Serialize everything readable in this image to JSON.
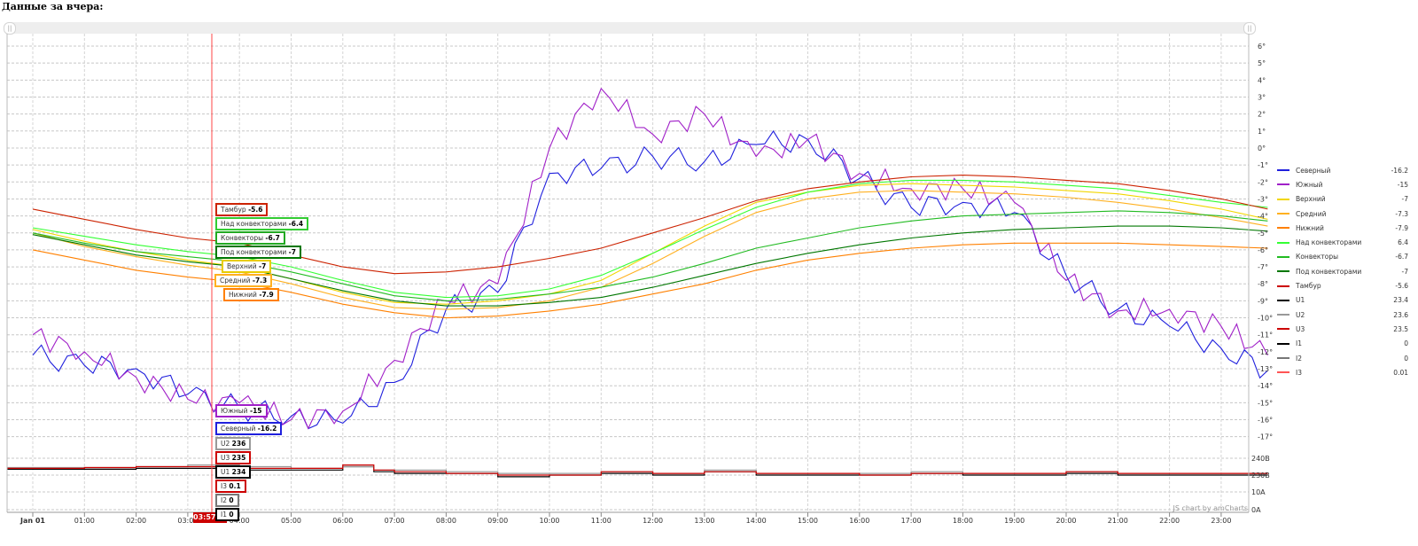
{
  "heading": "Данные за вчера:",
  "scroll": {
    "left_grip": "||",
    "right_grip": "||"
  },
  "credit": "JS chart by amCharts",
  "cursor_time": "03:57:15",
  "colors": {
    "north": "#2020dd",
    "south": "#a020c8",
    "top": "#f2d600",
    "middle": "#ffb020",
    "bottom": "#ff8000",
    "above_conv": "#33ff33",
    "conv": "#22bb22",
    "below_conv": "#007700",
    "tambur": "#cc2200",
    "u1": "#000000",
    "u2": "#999999",
    "u3": "#cc0000",
    "i1": "#000000",
    "i2": "#777777",
    "i3": "#ff5555"
  },
  "legend": [
    {
      "name": "Северный",
      "value": "-16.2",
      "color": "#2020dd"
    },
    {
      "name": "Южный",
      "value": "-15",
      "color": "#a020c8"
    },
    {
      "name": "Верхний",
      "value": "-7",
      "color": "#f2d600"
    },
    {
      "name": "Средний",
      "value": "-7.3",
      "color": "#ffb020"
    },
    {
      "name": "Нижний",
      "value": "-7.9",
      "color": "#ff8000"
    },
    {
      "name": "Над конвекторами",
      "value": "6.4",
      "color": "#33ff33"
    },
    {
      "name": "Конвекторы",
      "value": "-6.7",
      "color": "#22bb22"
    },
    {
      "name": "Под конвекторами",
      "value": "-7",
      "color": "#007700"
    },
    {
      "name": "Тамбур",
      "value": "-5.6",
      "color": "#cc0000"
    },
    {
      "name": "U1",
      "value": "23.4",
      "color": "#000000"
    },
    {
      "name": "U2",
      "value": "23.6",
      "color": "#999999"
    },
    {
      "name": "U3",
      "value": "23.5",
      "color": "#cc0000"
    },
    {
      "name": "I1",
      "value": "0",
      "color": "#000000"
    },
    {
      "name": "I2",
      "value": "0",
      "color": "#777777"
    },
    {
      "name": "I3",
      "value": "0.01",
      "color": "#ff5555"
    }
  ],
  "balloons": [
    {
      "label": "Тамбур",
      "value": "-5.6",
      "color": "#cc2200"
    },
    {
      "label": "Над конвекторами",
      "value": "-6.4",
      "color": "#33cc33"
    },
    {
      "label": "Конвекторы",
      "value": "-6.7",
      "color": "#22aa22"
    },
    {
      "label": "Под конвекторами",
      "value": "-7",
      "color": "#007700"
    },
    {
      "label": "Верхний",
      "value": "-7",
      "color": "#e8cc00"
    },
    {
      "label": "Средний",
      "value": "-7.3",
      "color": "#ffb020"
    },
    {
      "label": "Нижний",
      "value": "-7.9",
      "color": "#ff8000"
    },
    {
      "label": "Южный",
      "value": "-15",
      "color": "#a020c8"
    },
    {
      "label": "Северный",
      "value": "-16.2",
      "color": "#2020dd"
    },
    {
      "label": "U2",
      "value": "236",
      "color": "#999999"
    },
    {
      "label": "U3",
      "value": "235",
      "color": "#cc0000"
    },
    {
      "label": "U1",
      "value": "234",
      "color": "#000000"
    },
    {
      "label": "I3",
      "value": "0.1",
      "color": "#cc0000"
    },
    {
      "label": "I2",
      "value": "0",
      "color": "#777777"
    },
    {
      "label": "I1",
      "value": "0",
      "color": "#000000"
    }
  ],
  "chart_data": {
    "type": "line",
    "x_ticks": [
      "Jan 01",
      "01:00",
      "02:00",
      "03:00",
      "04:00",
      "05:00",
      "06:00",
      "07:00",
      "08:00",
      "09:00",
      "10:00",
      "11:00",
      "12:00",
      "13:00",
      "14:00",
      "15:00",
      "16:00",
      "17:00",
      "18:00",
      "19:00",
      "20:00",
      "21:00",
      "22:00",
      "23:00"
    ],
    "y_ticks": [
      "6°",
      "5°",
      "4°",
      "3°",
      "2°",
      "1°",
      "0°",
      "-1°",
      "-2°",
      "-3°",
      "-4°",
      "-5°",
      "-6°",
      "-7°",
      "-8°",
      "-9°",
      "-10°",
      "-11°",
      "-12°",
      "-13°",
      "-14°",
      "-15°",
      "-16°",
      "-17°"
    ],
    "y2_ticks": [
      "240В",
      "230В",
      "10А",
      "0А"
    ],
    "ylim": [
      -17,
      6
    ],
    "x_hours": [
      0,
      1,
      2,
      3,
      4,
      5,
      6,
      7,
      8,
      9,
      10,
      11,
      12,
      13,
      14,
      15,
      16,
      17,
      18,
      19,
      20,
      21,
      22,
      23,
      23.9
    ],
    "series": [
      {
        "name": "Северный",
        "color": "#2020dd",
        "values": [
          -12.2,
          -12.8,
          -13,
          -14.5,
          -15.3,
          -15.8,
          -16.2,
          -13.8,
          -9.5,
          -8.5,
          -1.5,
          -1.2,
          -0.5,
          -0.8,
          0.2,
          0.5,
          -1.8,
          -3.5,
          -3.2,
          -3.8,
          -7.5,
          -9.5,
          -10.5,
          -11.8,
          -13.1
        ]
      },
      {
        "name": "Южный",
        "color": "#a020c8",
        "values": [
          -11,
          -12,
          -13.5,
          -14.8,
          -15,
          -16,
          -15.5,
          -12.5,
          -9,
          -8,
          0,
          3.5,
          0.8,
          2,
          -0.5,
          0.5,
          -1.5,
          -2.4,
          -2.4,
          -3.2,
          -7.8,
          -9.6,
          -9.5,
          -10.5,
          -12.2
        ]
      },
      {
        "name": "Верхний",
        "color": "#f2d600",
        "values": [
          -4.8,
          -5.5,
          -6.1,
          -6.6,
          -7,
          -7.7,
          -8.5,
          -9.1,
          -9.2,
          -9,
          -8.6,
          -7.8,
          -6.2,
          -4.6,
          -3.2,
          -2.6,
          -2.2,
          -2.1,
          -2.2,
          -2.3,
          -2.5,
          -2.7,
          -3.1,
          -3.6,
          -4.2
        ]
      },
      {
        "name": "Средний",
        "color": "#ffb020",
        "values": [
          -5,
          -5.8,
          -6.4,
          -6.9,
          -7.3,
          -8,
          -8.8,
          -9.4,
          -9.5,
          -9.4,
          -9,
          -8.2,
          -6.8,
          -5.2,
          -3.8,
          -3,
          -2.6,
          -2.5,
          -2.6,
          -2.7,
          -2.9,
          -3.2,
          -3.6,
          -4.1,
          -4.6
        ]
      },
      {
        "name": "Нижний",
        "color": "#ff8000",
        "values": [
          -6,
          -6.6,
          -7.2,
          -7.6,
          -7.9,
          -8.5,
          -9.2,
          -9.7,
          -10,
          -9.9,
          -9.6,
          -9.2,
          -8.6,
          -8,
          -7.2,
          -6.6,
          -6.2,
          -5.9,
          -5.7,
          -5.6,
          -5.6,
          -5.6,
          -5.7,
          -5.8,
          -5.9
        ]
      },
      {
        "name": "Над конвекторами",
        "color": "#33ff33",
        "values": [
          -4.7,
          -5.2,
          -5.7,
          -6.1,
          -6.4,
          -7,
          -7.8,
          -8.5,
          -8.8,
          -8.7,
          -8.3,
          -7.5,
          -6.2,
          -4.8,
          -3.5,
          -2.6,
          -2.1,
          -1.9,
          -1.9,
          -2,
          -2.2,
          -2.4,
          -2.8,
          -3.2,
          -3.5
        ]
      },
      {
        "name": "Конвекторы",
        "color": "#22bb22",
        "values": [
          -5,
          -5.6,
          -6.1,
          -6.4,
          -6.7,
          -7.3,
          -8,
          -8.7,
          -9,
          -8.9,
          -8.6,
          -8.2,
          -7.6,
          -6.8,
          -5.9,
          -5.3,
          -4.7,
          -4.3,
          -4,
          -3.9,
          -3.8,
          -3.7,
          -3.8,
          -4,
          -4.3
        ]
      },
      {
        "name": "Под конвекторами",
        "color": "#007700",
        "values": [
          -5.1,
          -5.7,
          -6.3,
          -6.7,
          -7,
          -7.7,
          -8.4,
          -9,
          -9.3,
          -9.3,
          -9.1,
          -8.8,
          -8.2,
          -7.5,
          -6.8,
          -6.2,
          -5.7,
          -5.3,
          -5,
          -4.8,
          -4.7,
          -4.6,
          -4.6,
          -4.7,
          -4.9
        ]
      },
      {
        "name": "Тамбур",
        "color": "#cc2200",
        "values": [
          -3.6,
          -4.2,
          -4.8,
          -5.3,
          -5.6,
          -6.3,
          -7,
          -7.4,
          -7.3,
          -7,
          -6.5,
          -5.9,
          -5,
          -4.1,
          -3.1,
          -2.4,
          -2,
          -1.7,
          -1.6,
          -1.7,
          -1.9,
          -2.1,
          -2.5,
          -3,
          -3.6
        ]
      }
    ],
    "lower_x_hours": [
      0,
      1,
      2,
      3,
      3.9,
      4,
      5,
      6,
      6.6,
      7,
      8,
      9,
      10,
      11,
      12,
      13,
      14,
      15,
      16,
      17,
      18,
      19,
      20,
      21,
      22,
      23,
      23.9
    ],
    "lower_series": [
      {
        "name": "U1",
        "color": "#000000",
        "values": [
          233.5,
          233.5,
          234,
          234,
          234,
          233,
          233,
          235,
          232,
          231,
          231,
          229,
          230,
          231,
          230,
          232,
          230,
          230,
          230,
          231,
          230,
          230,
          231,
          230,
          230,
          230,
          230
        ]
      },
      {
        "name": "U2",
        "color": "#999999",
        "values": [
          234.5,
          234.5,
          235,
          236,
          236,
          235,
          234,
          235,
          233,
          233,
          232,
          231,
          231,
          232,
          231,
          233,
          231,
          231,
          231,
          232,
          231,
          231,
          232,
          231,
          231,
          231,
          231
        ]
      },
      {
        "name": "U3",
        "color": "#cc0000",
        "values": [
          234,
          234.5,
          235,
          235,
          235,
          234,
          234,
          236,
          233,
          232,
          231,
          230,
          230,
          232,
          231,
          232,
          231,
          231,
          230,
          231,
          231,
          231,
          232,
          231,
          231,
          231,
          231
        ]
      }
    ]
  }
}
